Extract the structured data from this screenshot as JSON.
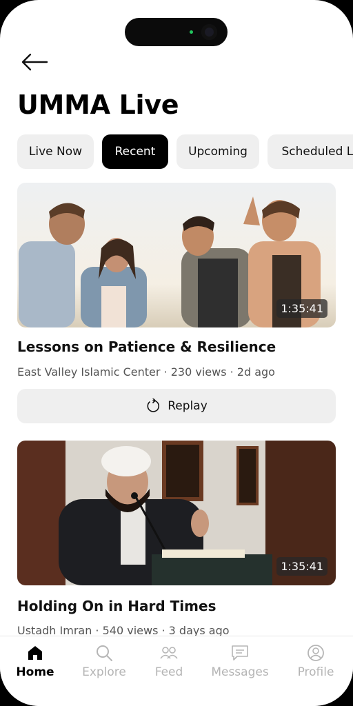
{
  "header": {
    "title": "UMMA Live"
  },
  "filters": [
    {
      "label": "Live Now",
      "active": false
    },
    {
      "label": "Recent",
      "active": true
    },
    {
      "label": "Upcoming",
      "active": false
    },
    {
      "label": "Scheduled Live",
      "active": false
    }
  ],
  "videos": [
    {
      "title": "Lessons on Patience & Resilience",
      "meta": "East Valley Islamic Center · 230 views · 2d ago",
      "duration": "1:35:41",
      "action_label": "Replay"
    },
    {
      "title": "Holding On in Hard Times",
      "meta": "Ustadh Imran · 540 views · 3 days ago",
      "duration": "1:35:41"
    }
  ],
  "tabbar": {
    "items": [
      {
        "label": "Home",
        "icon": "home-icon",
        "active": true
      },
      {
        "label": "Explore",
        "icon": "search-icon",
        "active": false
      },
      {
        "label": "Feed",
        "icon": "people-icon",
        "active": false
      },
      {
        "label": "Messages",
        "icon": "message-icon",
        "active": false
      },
      {
        "label": "Profile",
        "icon": "profile-icon",
        "active": false
      }
    ]
  },
  "colors": {
    "accent": "#000000",
    "chip_bg": "#efefef",
    "inactive_tab": "#b5b5b5"
  }
}
